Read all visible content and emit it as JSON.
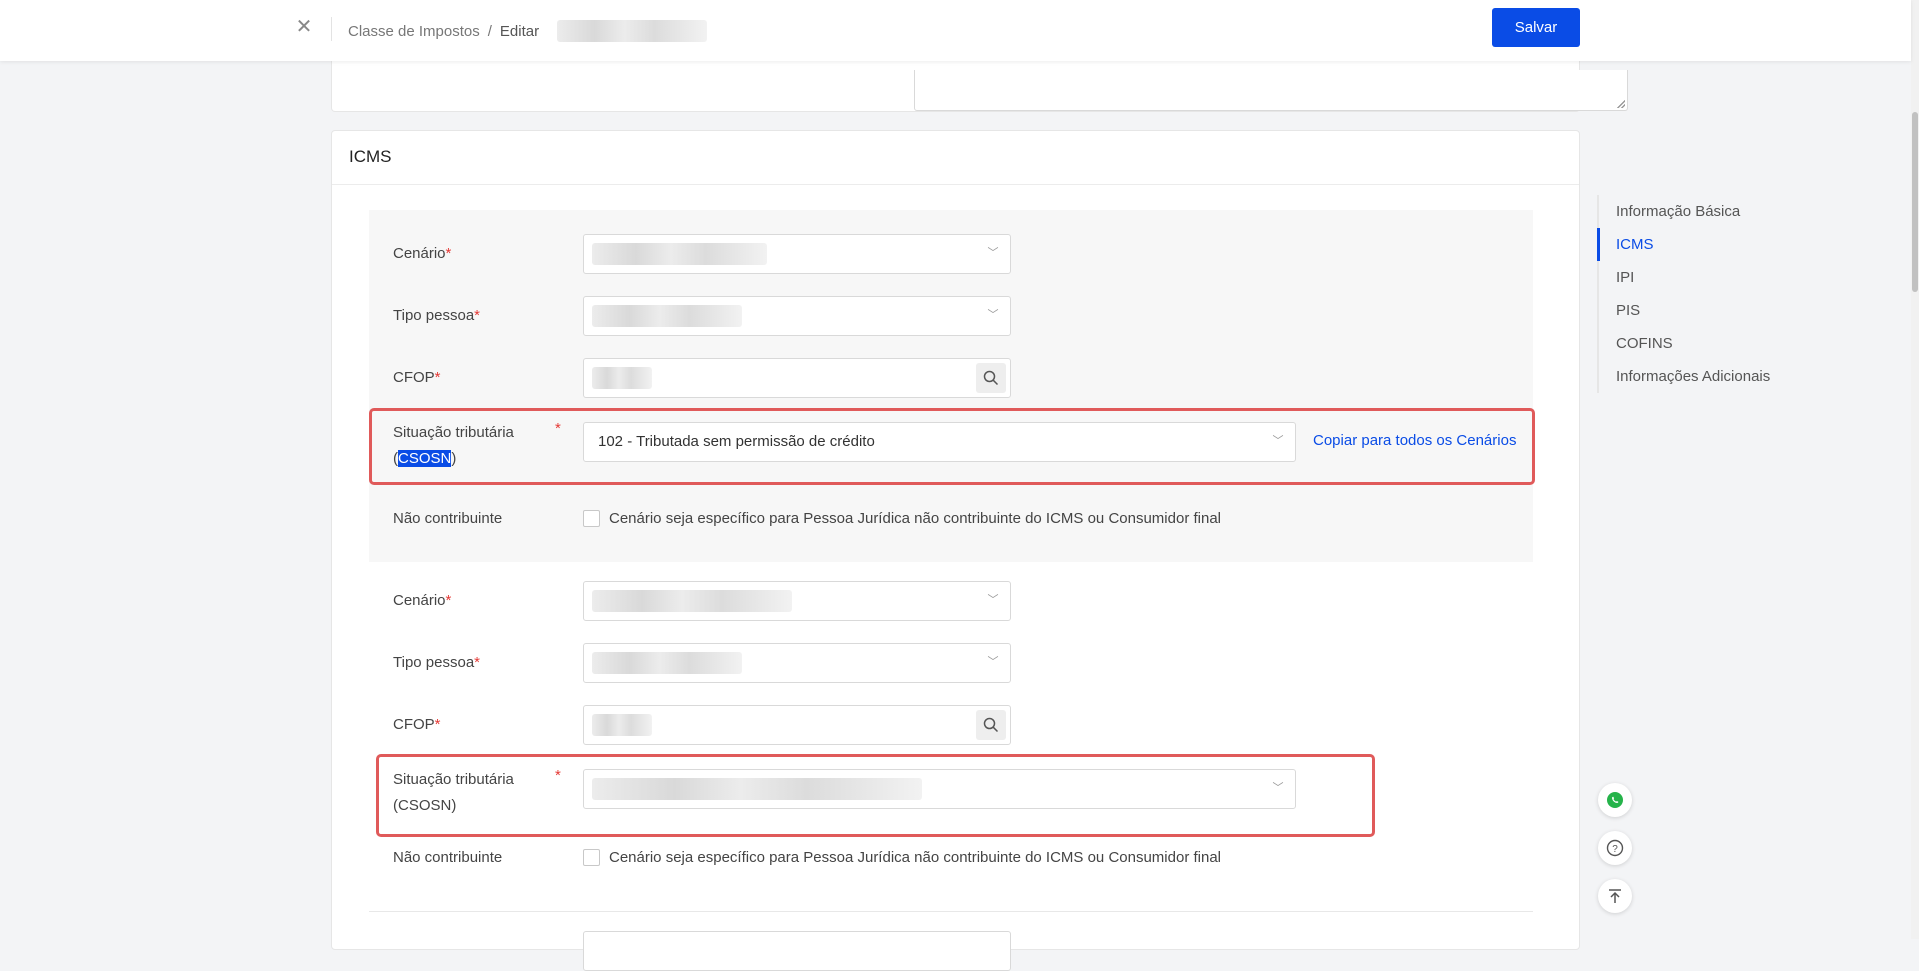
{
  "header": {
    "close_icon": "close-icon",
    "breadcrumb": {
      "parent": "Classe de Impostos",
      "separator": "/",
      "current": "Editar"
    },
    "save_label": "Salvar"
  },
  "icms": {
    "title": "ICMS",
    "labels": {
      "cenario": "Cenário",
      "tipo_pessoa": "Tipo pessoa",
      "cfop": "CFOP",
      "situacao_line1": "Situação tributária",
      "situacao_line2_open": "(",
      "situacao_line2_sel": "CSOSN",
      "situacao_line2_close": ")",
      "situacao_line2_full": "(CSOSN)",
      "nao_contribuinte": "Não contribuinte",
      "required_mark": "*"
    },
    "scenario1": {
      "situacao_value": "102 - Tributada sem permissão de crédito",
      "copy_link": "Copiar para todos os Cenários",
      "checkbox_text": "Cenário seja específico para Pessoa Jurídica não contribuinte do ICMS ou Consumidor final"
    },
    "scenario2": {
      "checkbox_text": "Cenário seja específico para Pessoa Jurídica não contribuinte do ICMS ou Consumidor final"
    }
  },
  "right_nav": {
    "items": [
      {
        "label": "Informação Básica"
      },
      {
        "label": "ICMS"
      },
      {
        "label": "IPI"
      },
      {
        "label": "PIS"
      },
      {
        "label": "COFINS"
      },
      {
        "label": "Informações Adicionais"
      }
    ]
  },
  "floating": [
    "whatsapp-icon",
    "help-icon",
    "back-to-top-icon"
  ],
  "colors": {
    "primary": "#0a4ce6",
    "required": "#e53935",
    "highlight": "#e05a5a"
  }
}
